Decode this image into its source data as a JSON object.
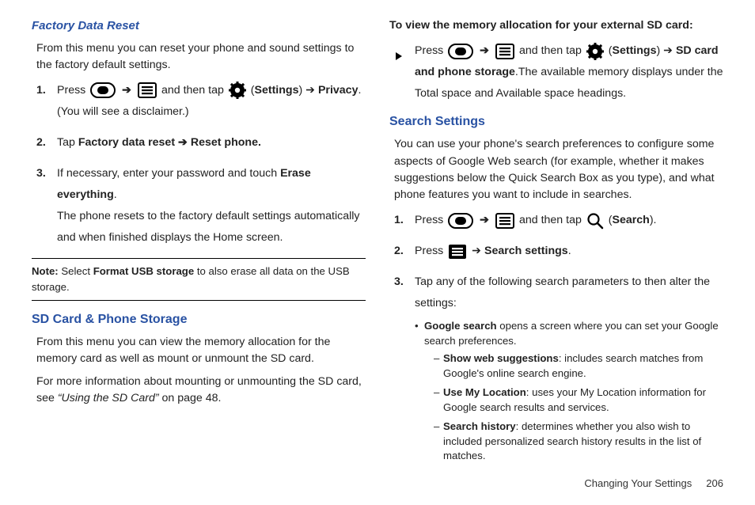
{
  "left": {
    "factory_heading": "Factory Data Reset",
    "factory_intro": "From this menu you can reset your phone and sound settings to the factory default settings.",
    "step1_a": "Press ",
    "step1_b": " and then tap ",
    "step1_c": " (",
    "settings_label": "Settings",
    "step1_d": ") ➔ ",
    "privacy_label": "Privacy",
    "step1_e": ". (You will see a disclaimer.)",
    "step2_a": "Tap ",
    "factory_reset_label": "Factory data reset ➔ Reset phone.",
    "step3_a": "If necessary, enter your password and touch ",
    "erase_label": "Erase everything",
    "step3_b": ".",
    "step3_c": "The phone resets to the factory default settings automatically and when finished displays the Home screen.",
    "note_prefix": "Note:",
    "note_a": " Select ",
    "format_usb": "Format USB storage",
    "note_b": " to also erase all data on the USB storage.",
    "sd_heading": "SD Card & Phone Storage",
    "sd_p1": "From this menu you can view the memory allocation for the memory card as well as mount or unmount the SD card.",
    "sd_p2_a": "For more information about mounting or unmounting the SD card, see ",
    "sd_p2_ref": "“Using the SD Card”",
    "sd_p2_b": " on page 48."
  },
  "right": {
    "view_line": "To view the memory allocation for your external SD card:",
    "r_step_a": "Press ",
    "r_step_b": " and then tap ",
    "r_step_c": " (",
    "settings_label": "Settings",
    "r_step_d": ") ➔ ",
    "sd_storage_label": "SD card and phone storage",
    "r_step_e": ".The available memory displays under the Total space and Available space headings.",
    "search_heading": "Search Settings",
    "search_intro": "You can use your phone's search preferences to configure some aspects of Google Web search (for example, whether it makes suggestions below the Quick Search Box as you type), and what phone features you want to include in searches.",
    "s1_a": "Press ",
    "s1_b": " and then tap ",
    "s1_c": " (",
    "search_label": "Search",
    "s1_d": ").",
    "s2_a": "Press ",
    "s2_b": " ➔ ",
    "search_settings_label": "Search settings",
    "s2_c": ".",
    "s3_a": "Tap any of the following search parameters to then alter the settings:",
    "bullet1_b": "Google search",
    "bullet1_t": " opens a screen where you can set your Google search preferences.",
    "dash1_b": "Show web suggestions",
    "dash1_t": ": includes search matches from Google's online search engine.",
    "dash2_b": "Use My Location",
    "dash2_t": ": uses your My Location information for Google search results and services.",
    "dash3_b": "Search history",
    "dash3_t": ": determines whether you also wish to included personalized search history results in the list of matches."
  },
  "footer": {
    "section": "Changing Your Settings",
    "page": "206"
  },
  "nums": {
    "n1": "1.",
    "n2": "2.",
    "n3": "3."
  },
  "arrow": "➔"
}
